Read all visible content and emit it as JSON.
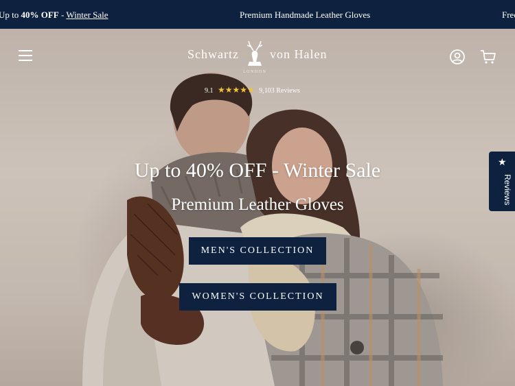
{
  "announcement": {
    "left_prefix": "Up to ",
    "left_bold": "40% OFF",
    "left_separator": " - ",
    "left_link": "Winter Sale",
    "center": "Premium Handmade Leather Gloves",
    "right": "Free"
  },
  "header": {
    "brand_word_1": "Schwartz",
    "brand_word_2": "von Halen",
    "brand_city": "LONDON",
    "rating_score": "9.1",
    "rating_stars": "★★★★★",
    "rating_reviews": "9,103 Reviews",
    "icons": [
      "menu-icon",
      "stag-logo",
      "account-icon",
      "cart-icon"
    ]
  },
  "hero": {
    "headline": "Up to 40% OFF - Winter Sale",
    "subheadline": "Premium Leather Gloves",
    "cta_men": "MEN'S COLLECTION",
    "cta_women": "WOMEN'S COLLECTION"
  },
  "reviews_tab": {
    "label": "Reviews",
    "icon": "star-icon"
  },
  "colors": {
    "navy": "#0e2240",
    "star_gold": "#f1c33c",
    "text_light": "#ffffff"
  }
}
